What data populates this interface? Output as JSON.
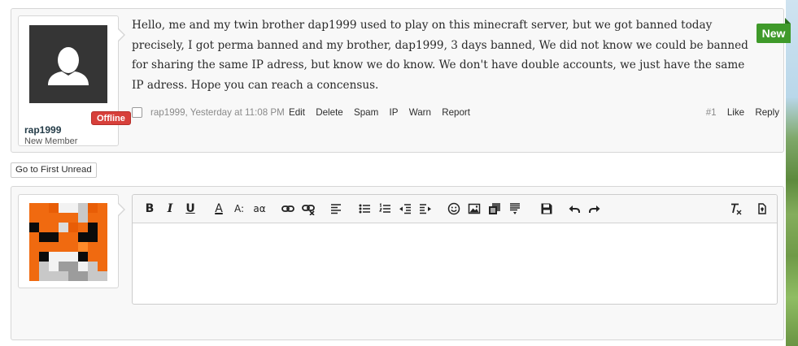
{
  "post": {
    "text": "Hello, me and my twin brother dap1999 used to play on this minecraft server, but we got banned today precisely, I got perma banned and my brother, dap1999, 3 days banned, We did not know we could be banned for sharing the same IP adress, but know we do know. We don't have double accounts, we just have the same IP adress. Hope you can reach a concensus.",
    "username": "rap1999",
    "user_title": "New Member",
    "status_badge": "Offline",
    "new_badge": "New",
    "author_date": "rap1999, Yesterday at 11:08 PM",
    "actions": {
      "edit": "Edit",
      "delete": "Delete",
      "spam": "Spam",
      "ip": "IP",
      "warn": "Warn",
      "report": "Report"
    },
    "post_number": "#1",
    "like": "Like",
    "reply": "Reply"
  },
  "go_to_first_unread": "Go to First Unread",
  "editor": {
    "toolbar": {
      "bold": "B",
      "italic": "I",
      "underline": "U",
      "font_color": "A",
      "font_size": "A:",
      "font_family": "aα"
    },
    "value": ""
  },
  "colors": {
    "offline": "#d7403b",
    "new": "#3f9a2a",
    "avatar_orange": "#f06a10"
  }
}
